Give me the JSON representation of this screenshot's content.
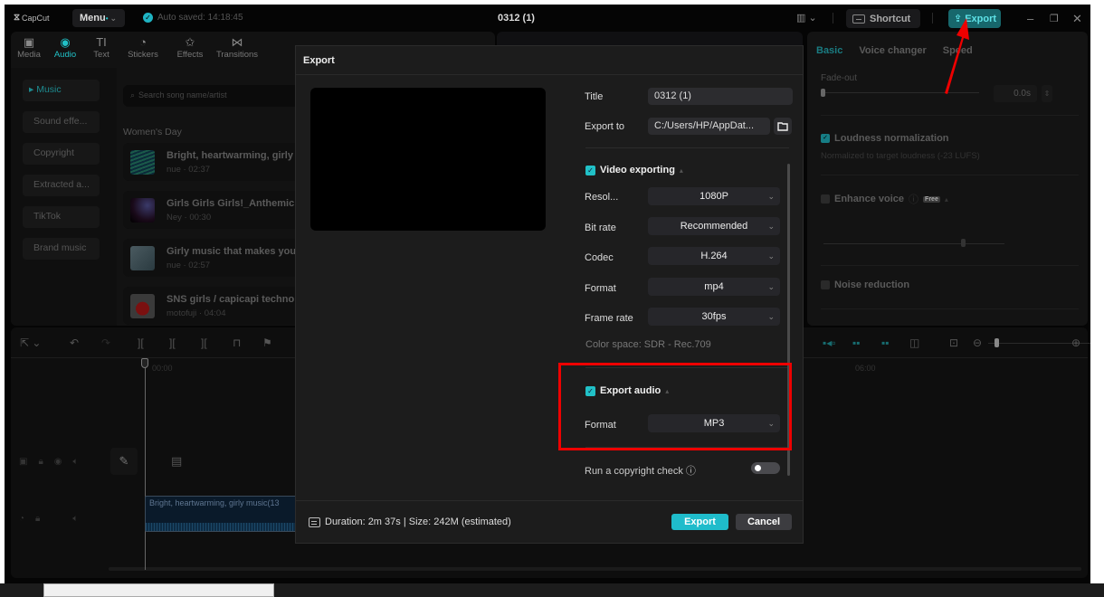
{
  "titlebar": {
    "logo": "CapCut",
    "menu_label": "Menu",
    "autosave_text": "Auto saved: 14:18:45",
    "project_title": "0312 (1)",
    "shortcut_label": "Shortcut",
    "export_label": "Export"
  },
  "tool_tabs": [
    {
      "label": "Media",
      "icon": "media-icon"
    },
    {
      "label": "Audio",
      "icon": "audio-icon",
      "active": true
    },
    {
      "label": "Text",
      "icon": "text-icon"
    },
    {
      "label": "Stickers",
      "icon": "stickers-icon"
    },
    {
      "label": "Effects",
      "icon": "effects-icon"
    },
    {
      "label": "Transitions",
      "icon": "transitions-icon"
    }
  ],
  "audio_sidebar": [
    {
      "label": "Music",
      "active": true
    },
    {
      "label": "Sound effe..."
    },
    {
      "label": "Copyright"
    },
    {
      "label": "Extracted a..."
    },
    {
      "label": "TikTok"
    },
    {
      "label": "Brand music"
    }
  ],
  "search": {
    "placeholder": "Search song name/artist"
  },
  "music_section": "Women's Day",
  "songs": [
    {
      "title": "Bright, heartwarming, girly music",
      "meta": "nue · 02:37"
    },
    {
      "title": "Girls Girls Girls!_Anthemic House",
      "meta": "Ney · 00:30"
    },
    {
      "title": "Girly music that makes you want to dance",
      "meta": "nue · 02:57"
    },
    {
      "title": "SNS girls / capicapi techno Lofi",
      "meta": "motofuji · 04:04"
    }
  ],
  "right_panel": {
    "tabs": [
      "Basic",
      "Voice changer",
      "Speed"
    ],
    "active_tab": "Basic",
    "fade_out_label": "Fade-out",
    "fade_out_value": "0.0s",
    "fade_out_fraction": 0.0,
    "loudness_label": "Loudness normalization",
    "loudness_checked": true,
    "loudness_desc": "Normalized to target loudness (-23 LUFS)",
    "enhance_label": "Enhance voice",
    "enhance_badge": "Free",
    "enhance_checked": false,
    "noise_label": "Noise reduction",
    "noise_checked": false
  },
  "timeline": {
    "ruler_start": "00:00",
    "ruler_mark": "06:00",
    "audio_clip_label": "Bright, heartwarming, girly music(13"
  },
  "export_dialog": {
    "title": "Export",
    "fields": {
      "title_label": "Title",
      "title_value": "0312 (1)",
      "export_to_label": "Export to",
      "export_to_value": "C:/Users/HP/AppDat..."
    },
    "video": {
      "section_label": "Video exporting",
      "checked": true,
      "resolution_label": "Resol...",
      "resolution_value": "1080P",
      "bitrate_label": "Bit rate",
      "bitrate_value": "Recommended",
      "codec_label": "Codec",
      "codec_value": "H.264",
      "format_label": "Format",
      "format_value": "mp4",
      "framerate_label": "Frame rate",
      "framerate_value": "30fps",
      "color_space": "Color space: SDR - Rec.709"
    },
    "audio": {
      "section_label": "Export audio",
      "checked": true,
      "format_label": "Format",
      "format_value": "MP3"
    },
    "copyright_label": "Run a copyright check",
    "copyright_enabled": false,
    "footer_info": "Duration: 2m 37s | Size: 242M (estimated)",
    "export_button": "Export",
    "cancel_button": "Cancel"
  },
  "colors": {
    "accent": "#21c1c7",
    "highlight_box": "#ee0000"
  }
}
